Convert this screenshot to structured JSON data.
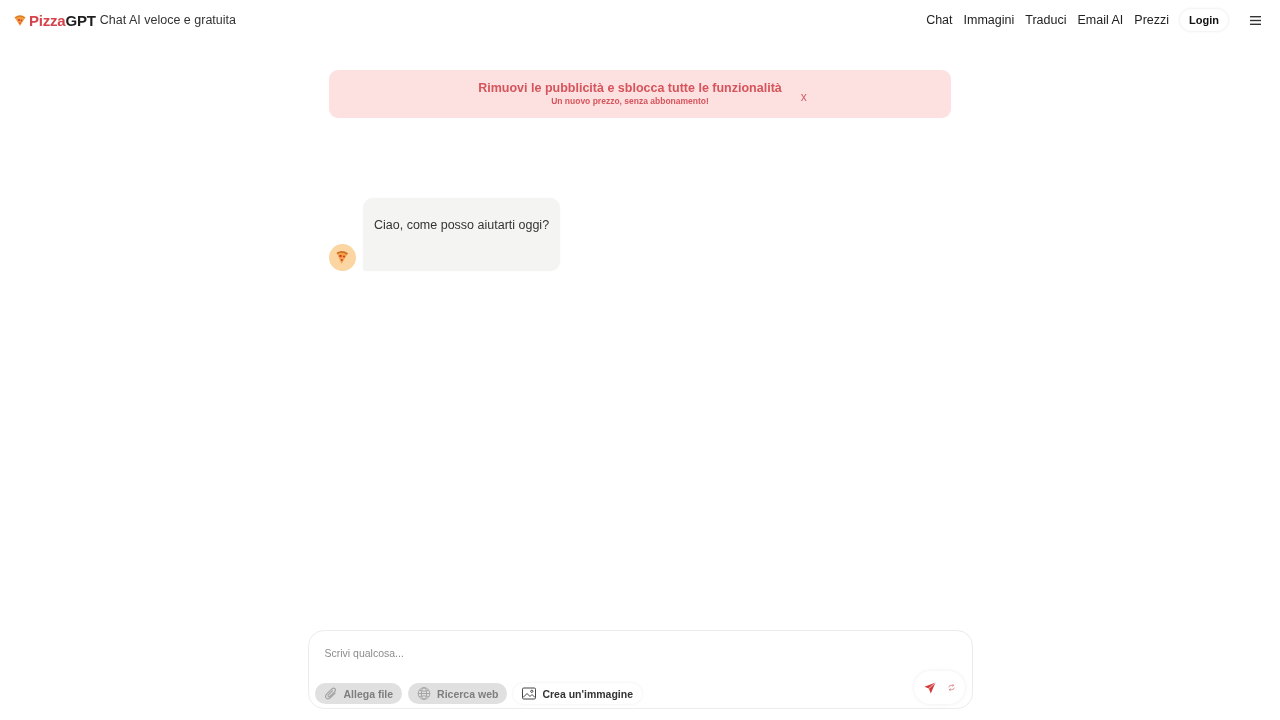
{
  "header": {
    "brand": {
      "first": "Pizza",
      "second": "GPT"
    },
    "tagline": "Chat AI veloce e gratuita",
    "nav": [
      {
        "label": "Chat"
      },
      {
        "label": "Immagini"
      },
      {
        "label": "Traduci"
      },
      {
        "label": "Email AI"
      },
      {
        "label": "Prezzi"
      }
    ],
    "login": "Login"
  },
  "banner": {
    "title": "Rimuovi le pubblicità e sblocca tutte le funzionalità",
    "subtitle": "Un nuovo prezzo, senza abbonamento!",
    "close": "x"
  },
  "messages": [
    {
      "kind": "assistant",
      "text": "Ciao, come posso aiutarti oggi?"
    }
  ],
  "composer": {
    "placeholder": "Scrivi qualcosa...",
    "tools": [
      {
        "kind": "attach",
        "label": "Allega file",
        "disabled": true
      },
      {
        "kind": "web",
        "label": "Ricerca web",
        "disabled": true
      },
      {
        "kind": "image",
        "label": "Crea un'immagine",
        "disabled": false
      }
    ]
  }
}
